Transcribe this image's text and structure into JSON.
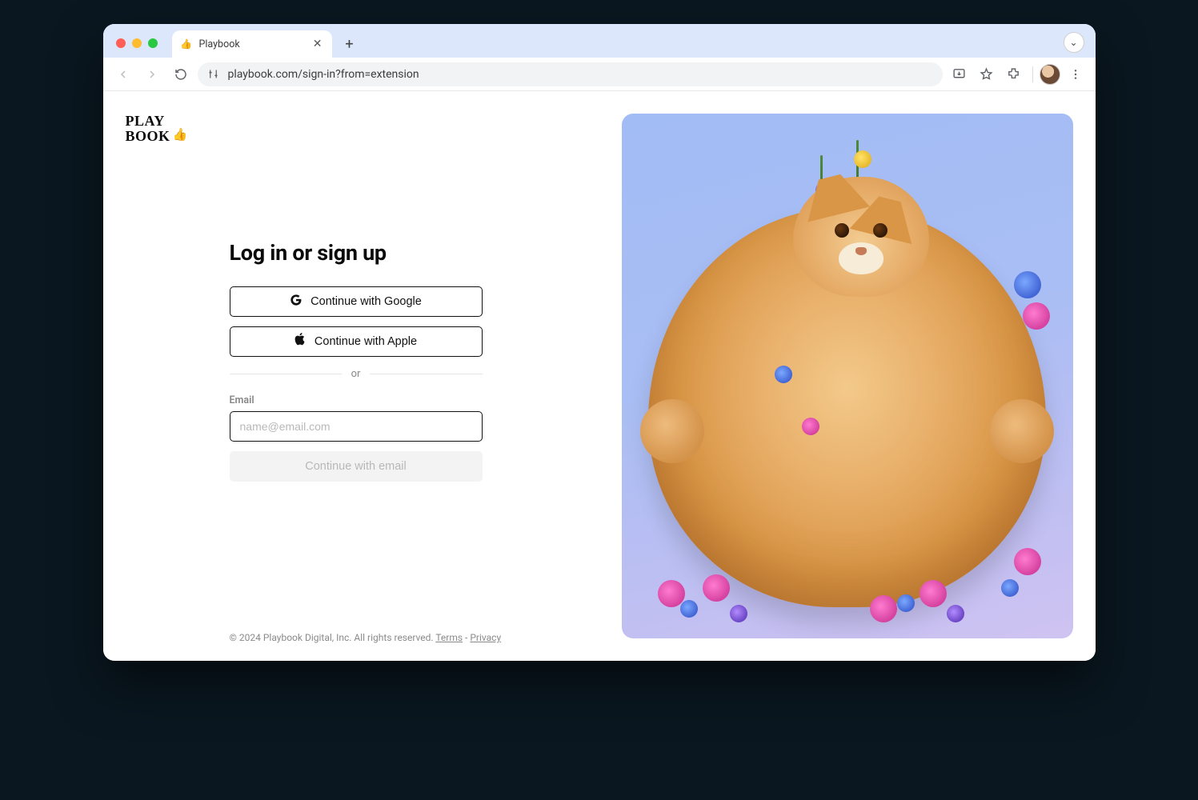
{
  "browser": {
    "tab_title": "Playbook",
    "url": "playbook.com/sign-in?from=extension"
  },
  "logo": {
    "line1": "PLAY",
    "line2": "BOOK"
  },
  "form": {
    "title": "Log in or sign up",
    "google_label": "Continue with Google",
    "apple_label": "Continue with Apple",
    "separator": "or",
    "email_label": "Email",
    "email_placeholder": "name@email.com",
    "continue_email_label": "Continue with email"
  },
  "footer": {
    "copyright": "© 2024 Playbook Digital, Inc. All rights reserved.",
    "terms": "Terms",
    "privacy": "Privacy",
    "dash": "-"
  }
}
